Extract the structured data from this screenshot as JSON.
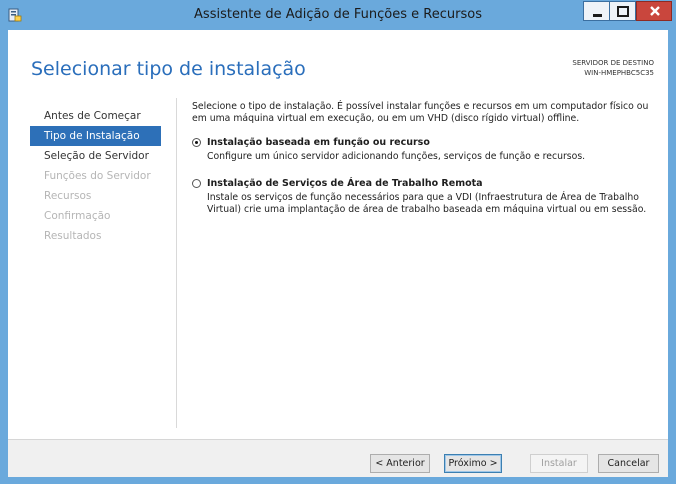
{
  "window": {
    "title": "Assistente de Adição de Funções e Recursos",
    "icon": "server-manager-icon"
  },
  "controls": {
    "minimize_icon": "minimize-icon",
    "maximize_icon": "maximize-icon",
    "close_icon": "close-icon"
  },
  "header": {
    "title": "Selecionar tipo de instalação",
    "dest_label": "SERVIDOR DE DESTINO",
    "dest_server": "WIN-HMEPHBC5C35"
  },
  "nav": {
    "items": [
      {
        "label": "Antes de Começar",
        "state": "normal"
      },
      {
        "label": "Tipo de Instalação",
        "state": "active"
      },
      {
        "label": "Seleção de Servidor",
        "state": "normal"
      },
      {
        "label": "Funções do Servidor",
        "state": "disabled"
      },
      {
        "label": "Recursos",
        "state": "disabled"
      },
      {
        "label": "Confirmação",
        "state": "disabled"
      },
      {
        "label": "Resultados",
        "state": "disabled"
      }
    ]
  },
  "content": {
    "intro": "Selecione o tipo de instalação. É possível instalar funções e recursos em um computador físico ou em uma máquina virtual em execução, ou em um VHD (disco rígido virtual) offline.",
    "options": [
      {
        "title": "Instalação baseada em função ou recurso",
        "description": "Configure um único servidor adicionando funções, serviços de função e recursos.",
        "selected": true
      },
      {
        "title": "Instalação de Serviços de Área de Trabalho Remota",
        "description": "Instale os serviços de função necessários para que a VDI (Infraestrutura de Área de Trabalho Virtual) crie uma implantação de área de trabalho baseada em máquina virtual ou em sessão.",
        "selected": false
      }
    ]
  },
  "footer": {
    "prev_label": "< Anterior",
    "next_label": "Próximo >",
    "install_label": "Instalar",
    "cancel_label": "Cancelar"
  },
  "colors": {
    "accent": "#2d70b8",
    "title_blue": "#2a6ebb",
    "frame": "#6aa9dc",
    "close": "#c9463d"
  }
}
